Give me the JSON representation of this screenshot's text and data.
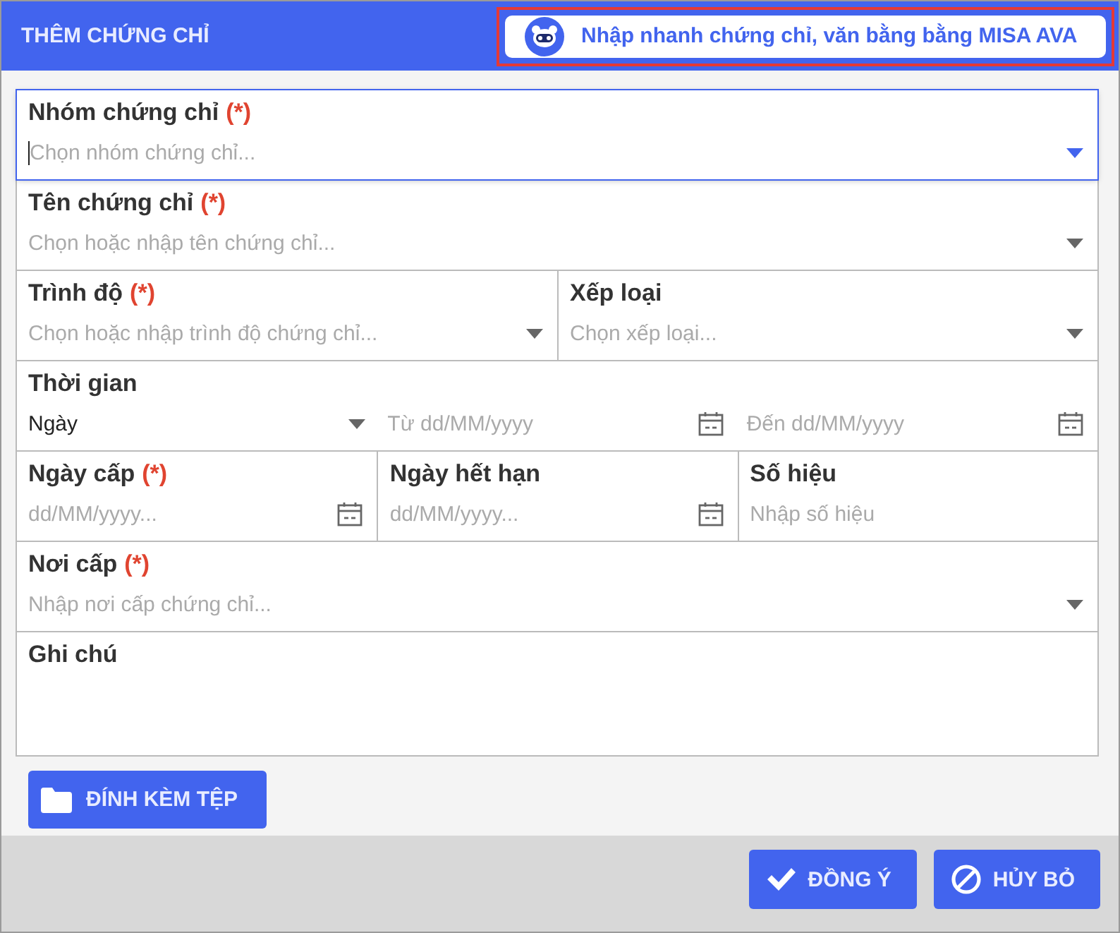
{
  "header": {
    "title": "THÊM CHỨNG CHỈ",
    "quick_entry_button": "Nhập nhanh chứng chỉ, văn bằng bằng MISA AVA",
    "highlighted": true
  },
  "rows": [
    {
      "kind": "fields",
      "fields": [
        {
          "label": "Nhóm chứng chỉ",
          "required_mark": "(*)",
          "placeholder": "Chọn nhóm chứng chỉ...",
          "kind": "dropdown",
          "focused": true
        }
      ]
    },
    {
      "kind": "fields",
      "fields": [
        {
          "label": "Tên chứng chỉ",
          "required_mark": "(*)",
          "placeholder": "Chọn hoặc nhập tên chứng chỉ...",
          "kind": "dropdown",
          "focused": false
        }
      ]
    },
    {
      "kind": "fields",
      "fields": [
        {
          "label": "Trình độ",
          "required_mark": "(*)",
          "placeholder": "Chọn hoặc nhập trình độ chứng chỉ...",
          "kind": "dropdown",
          "focused": false
        },
        {
          "label": "Xếp loại",
          "placeholder": "Chọn xếp loại...",
          "kind": "dropdown",
          "focused": false
        }
      ]
    },
    {
      "kind": "group",
      "label": "Thời gian",
      "fields": [
        {
          "value": "Ngày",
          "kind": "dropdown",
          "focused": false
        },
        {
          "placeholder": "Từ dd/MM/yyyy",
          "kind": "date",
          "focused": false
        },
        {
          "placeholder": "Đến dd/MM/yyyy",
          "kind": "date",
          "focused": false
        }
      ]
    },
    {
      "kind": "fields",
      "fields": [
        {
          "label": "Ngày cấp",
          "required_mark": "(*)",
          "placeholder": "dd/MM/yyyy...",
          "kind": "date",
          "focused": false
        },
        {
          "label": "Ngày hết hạn",
          "placeholder": "dd/MM/yyyy...",
          "kind": "date",
          "focused": false
        },
        {
          "label": "Số hiệu",
          "placeholder": "Nhập số hiệu",
          "kind": "text",
          "focused": false
        }
      ]
    },
    {
      "kind": "fields",
      "fields": [
        {
          "label": "Nơi cấp",
          "required_mark": "(*)",
          "placeholder": "Nhập nơi cấp chứng chỉ...",
          "kind": "dropdown",
          "focused": false
        }
      ]
    },
    {
      "kind": "notes",
      "label": "Ghi chú"
    }
  ],
  "attach_button": "ĐÍNH KÈM TỆP",
  "buttons": [
    {
      "label": "ĐỒNG Ý",
      "kind": "confirm"
    },
    {
      "label": "HỦY BỎ",
      "kind": "cancel"
    }
  ]
}
